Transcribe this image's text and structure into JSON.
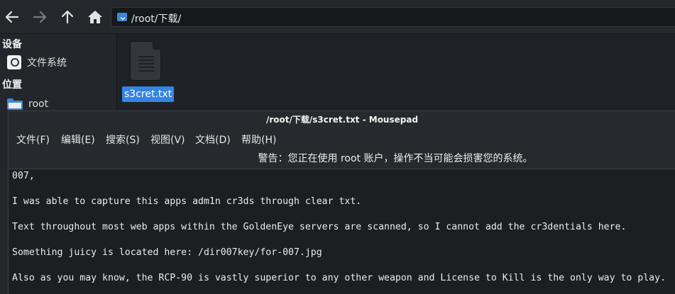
{
  "file_manager": {
    "toolbar": {
      "back_label": "",
      "forward_label": "",
      "up_label": "",
      "home_label": ""
    },
    "address": {
      "path": "/root/下载/"
    },
    "sidebar": {
      "sections": [
        {
          "header": "设备",
          "items": [
            {
              "label": "文件系统",
              "icon": "drive-icon"
            }
          ]
        },
        {
          "header": "位置",
          "items": [
            {
              "label": "root",
              "icon": "folder-icon"
            }
          ]
        }
      ]
    },
    "files": [
      {
        "name": "s3cret.txt",
        "icon": "text-document-icon",
        "selected": true
      }
    ]
  },
  "editor": {
    "title": "/root/下载/s3cret.txt - Mousepad",
    "menu": [
      "文件(F)",
      "编辑(E)",
      "搜索(S)",
      "视图(V)",
      "文档(D)",
      "帮助(H)"
    ],
    "warning": "警告：您正在使用 root 账户，操作不当可能会损害您的系统。",
    "lines": [
      "007,",
      "I was able to capture this apps adm1n cr3ds through clear txt.",
      "Text throughout most web apps within the GoldenEye servers are scanned, so I cannot add the cr3dentials here.",
      "Something juicy is located here: /dir007key/for-007.jpg",
      "Also as you may know, the RCP-90 is vastly superior to any other weapon and License to Kill is the only way to play."
    ]
  },
  "colors": {
    "selection": "#3584e4",
    "folder": "#3f87d6",
    "window_bg": "#26292d",
    "editor_bg": "#1c1f22"
  }
}
